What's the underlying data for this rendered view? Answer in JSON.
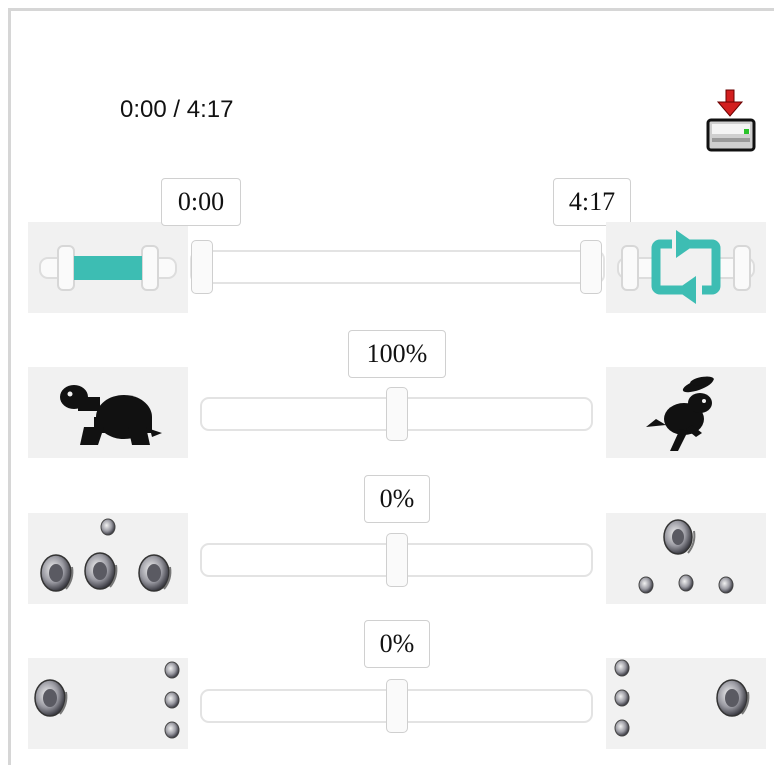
{
  "time": {
    "current": "0:00",
    "separator": " / ",
    "duration": "4:17"
  },
  "save": {
    "icon": "save-to-disk-icon"
  },
  "trim": {
    "start_label": "0:00",
    "end_label": "4:17",
    "start_fraction": 0,
    "end_fraction": 1,
    "left_icon": "trim-segment-icon",
    "right_icon": "loop-icon",
    "accent": "#3dbdb3"
  },
  "speed": {
    "label": "100%",
    "value_fraction": 0.5,
    "left_icon": "turtle-slow-icon",
    "right_icon": "rabbit-fast-icon"
  },
  "spread": {
    "label": "0%",
    "value_fraction": 0.5,
    "left_icon": "speakers-spread-icon",
    "right_icon": "speaker-focused-icon"
  },
  "balance": {
    "label": "0%",
    "value_fraction": 0.5,
    "left_icon": "speaker-left-icon",
    "right_icon": "speaker-right-icon"
  }
}
